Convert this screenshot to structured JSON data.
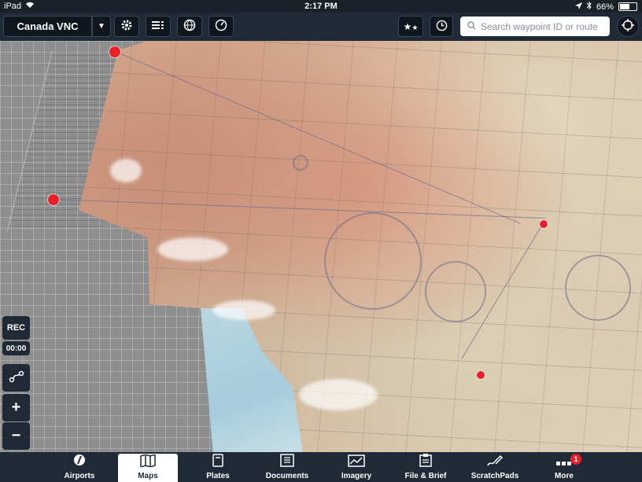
{
  "status_bar": {
    "device": "iPad",
    "time": "2:17 PM",
    "battery_text": "66%",
    "battery_level": 0.66
  },
  "toolbar": {
    "layer_label": "Canada VNC",
    "search_placeholder": "Search waypoint ID or route"
  },
  "map_controls": {
    "rec_label": "REC",
    "timer": "00:00",
    "zoom_in": "+",
    "zoom_out": "−"
  },
  "tabs": [
    {
      "label": "Airports",
      "icon": "compass-icon"
    },
    {
      "label": "Maps",
      "icon": "map-icon",
      "active": true
    },
    {
      "label": "Plates",
      "icon": "plates-icon"
    },
    {
      "label": "Documents",
      "icon": "documents-icon"
    },
    {
      "label": "Imagery",
      "icon": "imagery-icon"
    },
    {
      "label": "File & Brief",
      "icon": "clipboard-icon"
    },
    {
      "label": "ScratchPads",
      "icon": "pen-icon"
    },
    {
      "label": "More",
      "icon": "more-icon",
      "badge": "1"
    }
  ],
  "colors": {
    "bar_background": "#1f2a36",
    "marker_red": "#e8202a"
  }
}
